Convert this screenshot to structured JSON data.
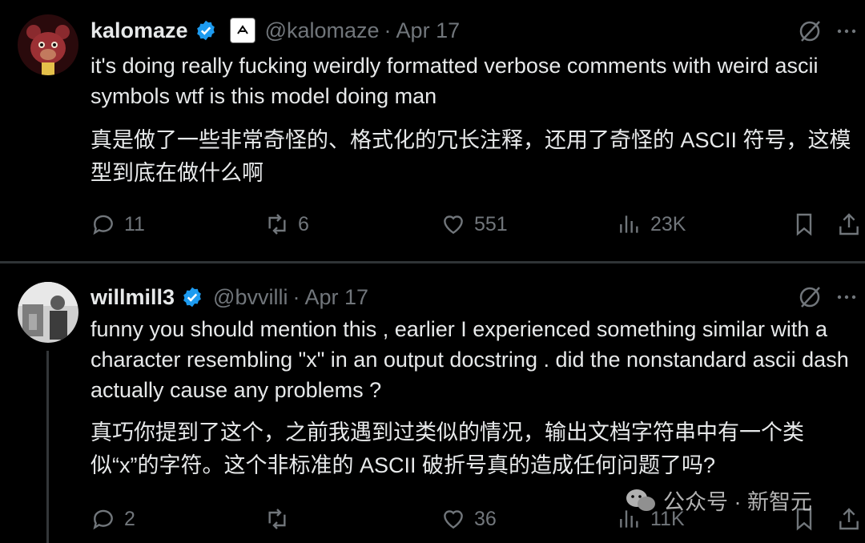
{
  "tweets": [
    {
      "name": "kalomaze",
      "handle": "@kalomaze",
      "date": "Apr 17",
      "text_en": "it's doing really fucking weirdly formatted verbose comments with weird ascii symbols wtf is this model doing man",
      "text_zh": "真是做了一些非常奇怪的、格式化的冗长注释，还用了奇怪的 ASCII 符号，这模型到底在做什么啊",
      "replies": "11",
      "reposts": "6",
      "likes": "551",
      "views": "23K"
    },
    {
      "name": "willmill3",
      "handle": "@bvvilli",
      "date": "Apr 17",
      "text_en": "funny you should mention this , earlier I experienced something similar with a character resembling \"x\" in an output docstring . did the nonstandard ascii dash actually cause any problems ?",
      "text_zh": "真巧你提到了这个，之前我遇到过类似的情况，输出文档字符串中有一个类似“x”的字符。这个非标准的 ASCII 破折号真的造成任何问题了吗?",
      "replies": "2",
      "reposts": "",
      "likes": "36",
      "views": "11K"
    }
  ],
  "separator": "·",
  "watermark": "公众号 · 新智元",
  "colors": {
    "background": "#000000",
    "text": "#e7e9ea",
    "muted": "#71767b",
    "verified": "#1d9bf0",
    "divider": "#2f3336"
  },
  "icons": [
    "verified-badge-icon",
    "grok-icon",
    "more-icon",
    "reply-icon",
    "repost-icon",
    "like-icon",
    "views-icon",
    "bookmark-icon",
    "share-icon"
  ]
}
